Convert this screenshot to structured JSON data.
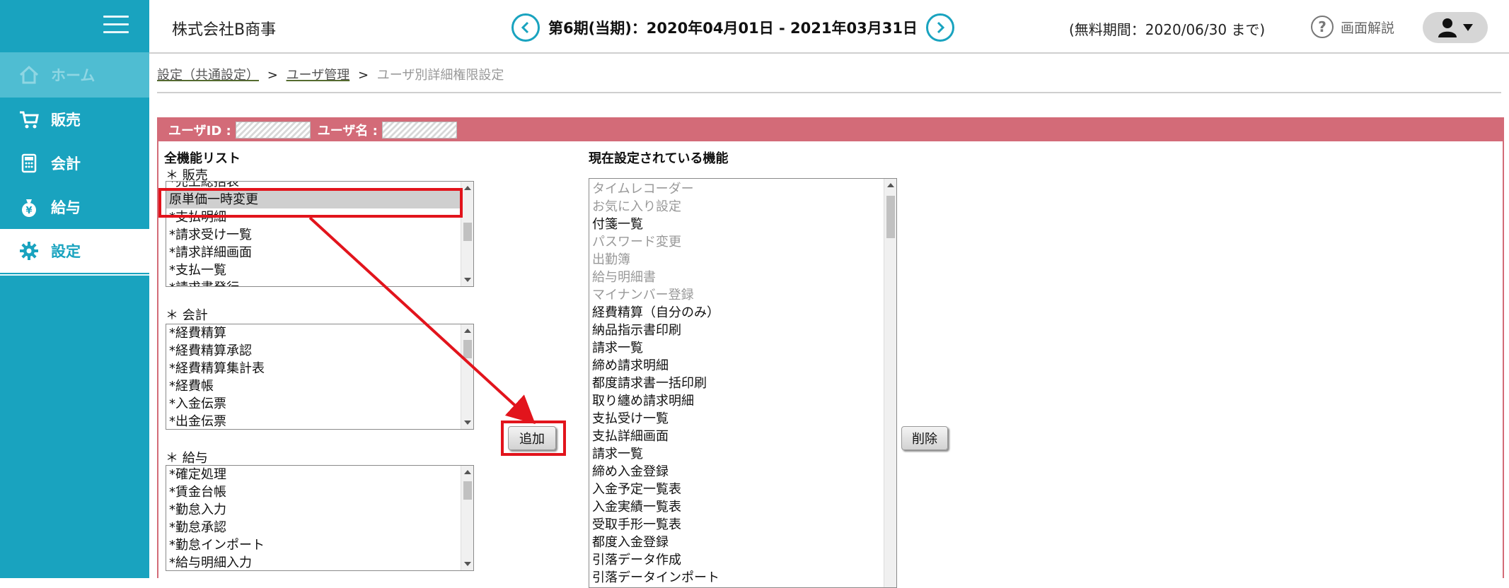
{
  "sidebar": {
    "items": [
      {
        "label": "ホーム",
        "icon": "home-icon"
      },
      {
        "label": "販売",
        "icon": "cart-icon"
      },
      {
        "label": "会計",
        "icon": "calculator-icon"
      },
      {
        "label": "給与",
        "icon": "money-bag-icon"
      },
      {
        "label": "設定",
        "icon": "gear-icon"
      }
    ],
    "active": "設定"
  },
  "header": {
    "company": "株式会社B商事",
    "period": "第6期(当期)：2020年04月01日 - 2021年03月31日",
    "trial": "(無料期間：2020/06/30 まで)",
    "help_label": "画面解説",
    "help_icon_glyph": "?"
  },
  "breadcrumb": {
    "items": [
      "設定（共通設定）",
      "ユーザ管理"
    ],
    "separator": ">",
    "current": "ユーザ別詳細権限設定"
  },
  "user_bar": {
    "id_label": "ユーザID :",
    "name_label": "ユーザ名 :"
  },
  "all_functions": {
    "title": "全機能リスト",
    "groups": [
      {
        "label": "＊ 販売",
        "items": [
          "*売上総括表",
          "原単価一時変更",
          "*支払明細",
          "*請求受け一覧",
          "*請求詳細画面",
          "*支払一覧",
          "*請求書発行"
        ],
        "selected_index": 1
      },
      {
        "label": "＊ 会計",
        "items": [
          "*経費精算",
          "*経費精算承認",
          "*経費精算集計表",
          "*経費帳",
          "*入金伝票",
          "*出金伝票"
        ]
      },
      {
        "label": "＊ 給与",
        "items": [
          "*確定処理",
          "*賃金台帳",
          "*勤怠入力",
          "*勤怠承認",
          "*勤怠インポート",
          "*給与明細入力"
        ]
      }
    ]
  },
  "current_functions": {
    "title": "現在設定されている機能",
    "items": [
      {
        "label": "タイムレコーダー",
        "disabled": true
      },
      {
        "label": "お気に入り設定",
        "disabled": true
      },
      {
        "label": "付箋一覧",
        "disabled": false
      },
      {
        "label": "パスワード変更",
        "disabled": true
      },
      {
        "label": "出勤簿",
        "disabled": true
      },
      {
        "label": "給与明細書",
        "disabled": true
      },
      {
        "label": "マイナンバー登録",
        "disabled": true
      },
      {
        "label": "経費精算（自分のみ）",
        "disabled": false
      },
      {
        "label": "納品指示書印刷",
        "disabled": false
      },
      {
        "label": "請求一覧",
        "disabled": false
      },
      {
        "label": "締め請求明細",
        "disabled": false
      },
      {
        "label": "都度請求書一括印刷",
        "disabled": false
      },
      {
        "label": "取り纏め請求明細",
        "disabled": false
      },
      {
        "label": "支払受け一覧",
        "disabled": false
      },
      {
        "label": "支払詳細画面",
        "disabled": false
      },
      {
        "label": "請求一覧",
        "disabled": false
      },
      {
        "label": "締め入金登録",
        "disabled": false
      },
      {
        "label": "入金予定一覧表",
        "disabled": false
      },
      {
        "label": "入金実績一覧表",
        "disabled": false
      },
      {
        "label": "受取手形一覧表",
        "disabled": false
      },
      {
        "label": "都度入金登録",
        "disabled": false
      },
      {
        "label": "引落データ作成",
        "disabled": false
      },
      {
        "label": "引落データインポート",
        "disabled": false
      }
    ]
  },
  "buttons": {
    "add": "追加",
    "delete": "削除"
  },
  "colors": {
    "sidebar": "#19a3bf",
    "user_bar": "#d36b78",
    "annotation": "#e2141c"
  }
}
